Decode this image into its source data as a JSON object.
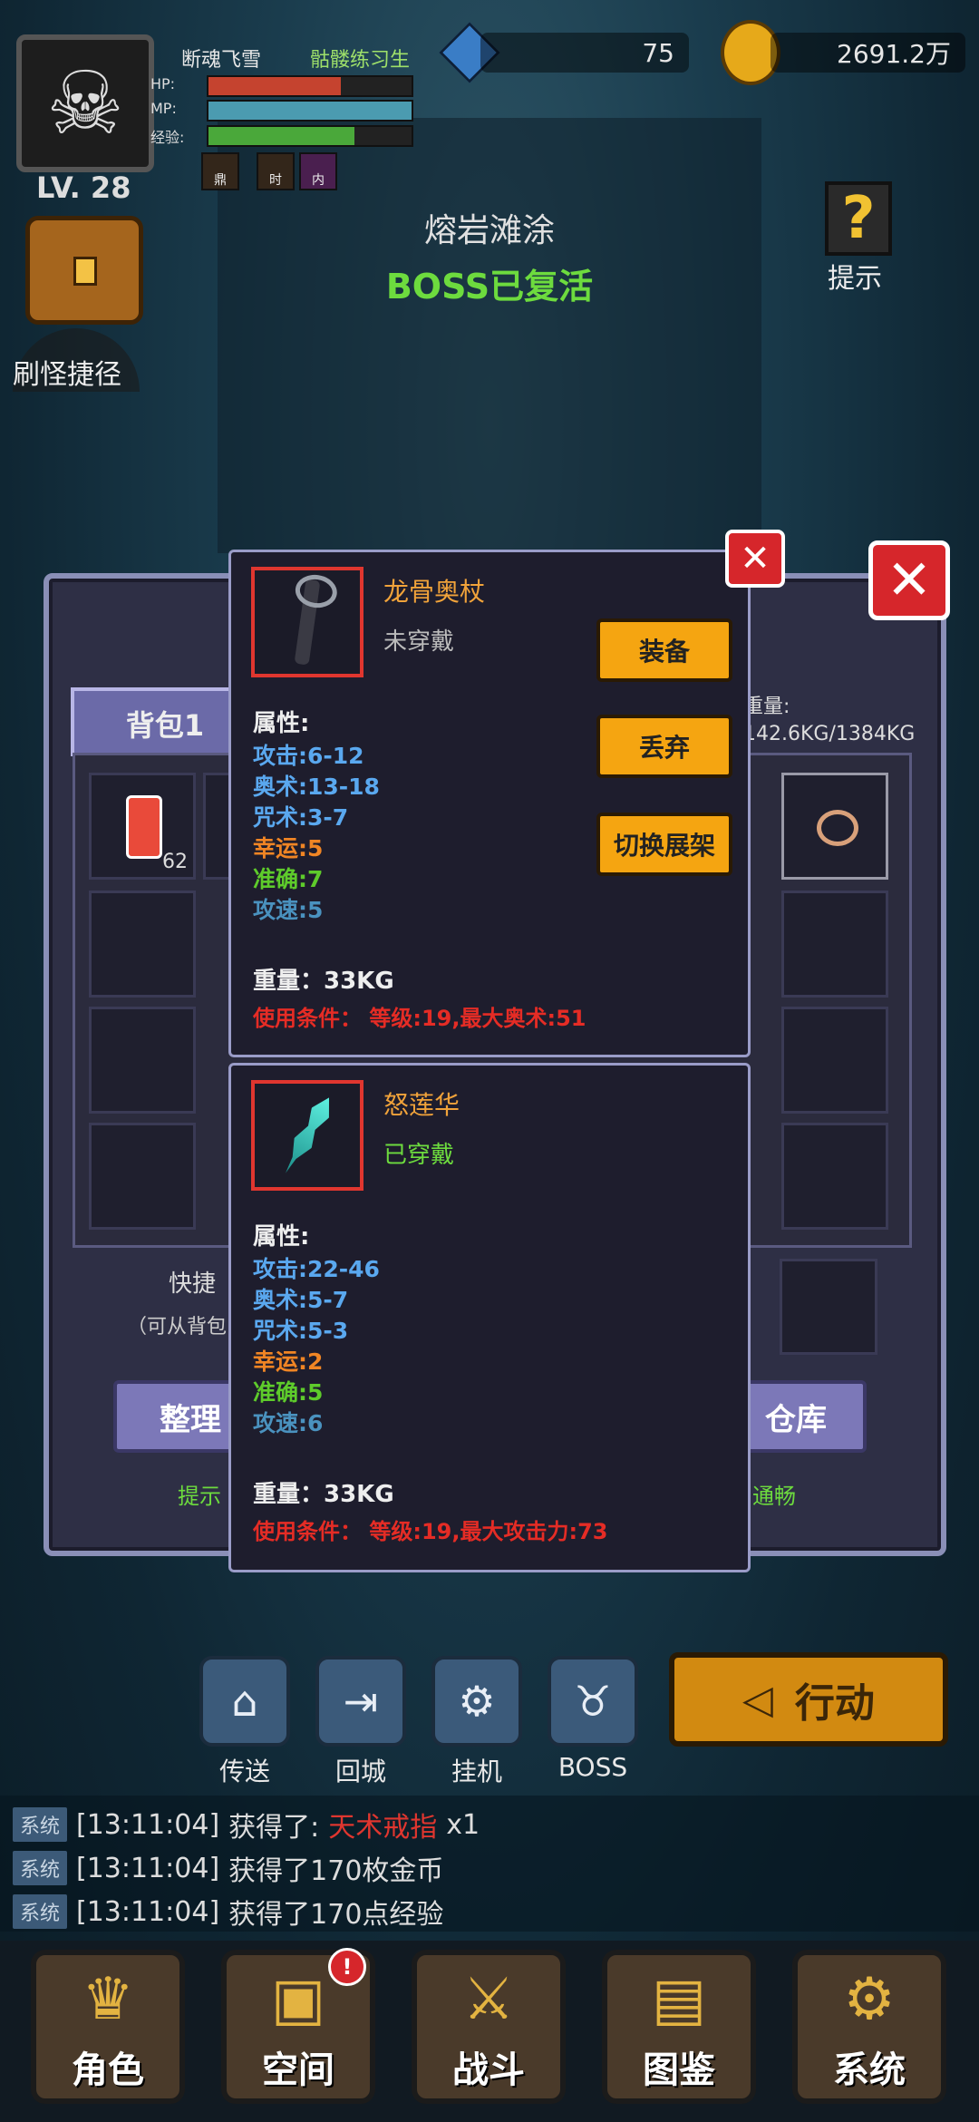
{
  "player": {
    "name": "断魂飞雪",
    "class": "骷髅练习生",
    "level": "LV. 28",
    "hp_label": "HP:",
    "mp_label": "MP:",
    "exp_label": "经验:",
    "hp": 0.65,
    "mp": 1.0,
    "exp": 0.72,
    "buffs": [
      "鼎",
      "时",
      "内"
    ]
  },
  "currency": {
    "gems": "75",
    "gold": "2691.2万"
  },
  "hud": {
    "shortcut_label": "刷怪捷径",
    "hint_label": "提示"
  },
  "zone": {
    "name": "熔岩滩涂",
    "status": "BOSS已复活"
  },
  "backpack": {
    "tab_label": "背包1",
    "weight_label": "重量:",
    "weight_value": "142.6KG/1384KG",
    "slot_count": "62",
    "quick_label": "快捷",
    "quick_hint": "（可从背包",
    "sort_button": "整理",
    "warehouse_button": "仓库",
    "tip_left": "提示",
    "tip_right": "通畅"
  },
  "tooltip_top": {
    "name": "龙骨奥杖",
    "status": "未穿戴",
    "section": "属性:",
    "stats": [
      {
        "text": "攻击:6-12",
        "color": "#5aa8ef"
      },
      {
        "text": "奥术:13-18",
        "color": "#5aa8ef"
      },
      {
        "text": "咒术:3-7",
        "color": "#5aa8ef"
      },
      {
        "text": "幸运:5",
        "color": "#f08524"
      },
      {
        "text": "准确:7",
        "color": "#5ecb2b"
      },
      {
        "text": "攻速:5",
        "color": "#4a92bf"
      }
    ],
    "weight": "重量：33KG",
    "requirement": "使用条件：  等级:19,最大奥术:51",
    "buttons": {
      "equip": "装备",
      "discard": "丢弃",
      "switch": "切换展架"
    }
  },
  "tooltip_bottom": {
    "name": "怒莲华",
    "status": "已穿戴",
    "section": "属性:",
    "stats": [
      {
        "text": "攻击:22-46",
        "color": "#5aa8ef"
      },
      {
        "text": "奥术:5-7",
        "color": "#5aa8ef"
      },
      {
        "text": "咒术:5-3",
        "color": "#5aa8ef"
      },
      {
        "text": "幸运:2",
        "color": "#f08524"
      },
      {
        "text": "准确:5",
        "color": "#5ecb2b"
      },
      {
        "text": "攻速:6",
        "color": "#4a92bf"
      }
    ],
    "weight": "重量：33KG",
    "requirement": "使用条件：  等级:19,最大攻击力:73"
  },
  "actions": {
    "teleport": "传送",
    "return": "回城",
    "idle": "挂机",
    "boss": "BOSS",
    "action": "行动"
  },
  "log": [
    {
      "tag": "系统",
      "time": "[13:11:04]",
      "text": "获得了:",
      "item": "天术戒指",
      "qty": "x1"
    },
    {
      "tag": "系统",
      "time": "[13:11:04]",
      "text": "获得了170枚金币",
      "item": "",
      "qty": ""
    },
    {
      "tag": "系统",
      "time": "[13:11:04]",
      "text": "获得了170点经验",
      "item": "",
      "qty": ""
    }
  ],
  "nav": {
    "character": "角色",
    "space": "空间",
    "battle": "战斗",
    "codex": "图鉴",
    "system": "系统"
  },
  "colors": {
    "accent_orange": "#f5a511",
    "close_red": "#d6262b",
    "boss_green": "#6ddb3e",
    "log_item_red": "#e0362f"
  }
}
